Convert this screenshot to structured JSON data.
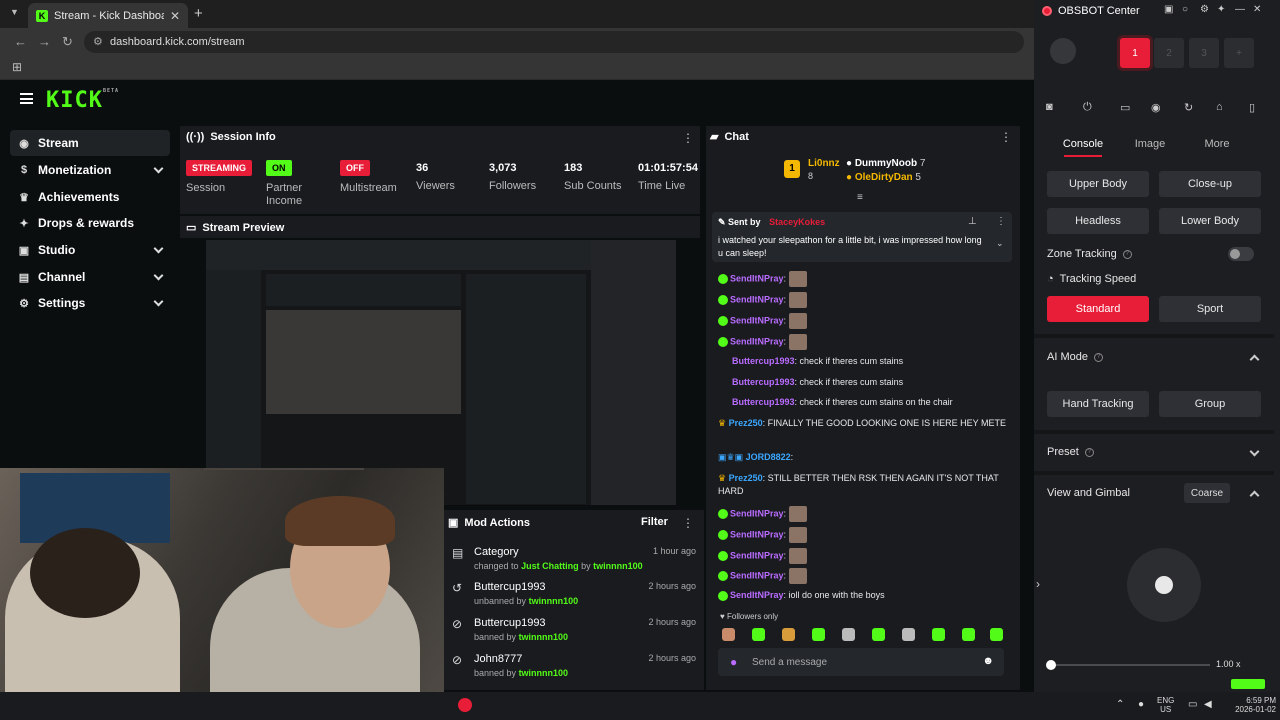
{
  "browser": {
    "tab_title": "Stream - Kick Dashboard",
    "url": "dashboard.kick.com/stream"
  },
  "kick": {
    "logo": "KICK",
    "logo_badge": "BETA",
    "sidebar": [
      {
        "label": "Stream",
        "icon": "broadcast-icon",
        "active": true
      },
      {
        "label": "Monetization",
        "icon": "dollar-icon",
        "expandable": true
      },
      {
        "label": "Achievements",
        "icon": "trophy-icon"
      },
      {
        "label": "Drops & rewards",
        "icon": "gift-icon"
      },
      {
        "label": "Studio",
        "icon": "studio-icon",
        "expandable": true
      },
      {
        "label": "Channel",
        "icon": "channel-icon",
        "expandable": true
      },
      {
        "label": "Settings",
        "icon": "gear-icon",
        "expandable": true
      }
    ],
    "session": {
      "title": "Session Info",
      "stats": [
        {
          "badge": "STREAMING",
          "label": "Session",
          "color": "#e81d38"
        },
        {
          "badge": "ON",
          "label": "Partner Income",
          "color": "#53fc18"
        },
        {
          "badge": "OFF",
          "label": "Multistream",
          "color": "#e81d38"
        },
        {
          "value": "36",
          "label": "Viewers"
        },
        {
          "value": "3,073",
          "label": "Followers"
        },
        {
          "value": "183",
          "label": "Sub Counts"
        },
        {
          "value": "01:01:57:54",
          "label": "Time Live"
        }
      ]
    },
    "preview": {
      "title": "Stream Preview"
    },
    "mod_actions": {
      "title": "Mod Actions",
      "filter": "Filter",
      "items": [
        {
          "user": "Category",
          "action": "changed to",
          "target": "Just Chatting",
          "by_word": "by",
          "by": "twinnnn100",
          "time": "1 hour ago",
          "icon": "category-icon"
        },
        {
          "user": "Buttercup1993",
          "action": "unbanned by",
          "by": "twinnnn100",
          "time": "2 hours ago",
          "icon": "unban-icon"
        },
        {
          "user": "Buttercup1993",
          "action": "banned by",
          "by": "twinnnn100",
          "time": "2 hours ago",
          "icon": "ban-icon"
        },
        {
          "user": "John8777",
          "action": "banned by",
          "by": "twinnnn100",
          "time": "2 hours ago",
          "icon": "ban-icon"
        }
      ]
    },
    "chat": {
      "title": "Chat",
      "leaderboard": [
        {
          "rank": "1",
          "name": "Li0nnz",
          "count": "8"
        },
        {
          "name": "DummyNoob",
          "count": "7"
        },
        {
          "name": "OleDirtyDan",
          "count": "5"
        }
      ],
      "pinned": {
        "sent_by": "Sent by",
        "author": "StaceyKokes",
        "text": "i watched your sleepathon for a little bit, i was impressed how long u can sleep!"
      },
      "lines": [
        {
          "user": "SendItNPray",
          "text": ":",
          "color": "#b96cff",
          "photo": true
        },
        {
          "user": "SendItNPray",
          "text": ":",
          "color": "#b96cff",
          "photo": true
        },
        {
          "user": "SendItNPray",
          "text": ":",
          "color": "#b96cff",
          "photo": true
        },
        {
          "user": "SendItNPray",
          "text": ":",
          "color": "#b96cff",
          "photo": true
        },
        {
          "user": "Buttercup1993",
          "text": ": check if theres cum stains",
          "color": "#b96cff"
        },
        {
          "user": "Buttercup1993",
          "text": ": check if theres cum stains",
          "color": "#b96cff"
        },
        {
          "user": "Buttercup1993",
          "text": ": check if theres cum stains on the chair",
          "color": "#b96cff"
        },
        {
          "user": "Prez250",
          "text": ": FINALLY THE GOOD LOOKING ONE IS HERE HEY METE",
          "color": "#3ba7ff"
        },
        {
          "user": "JORD8822",
          "text": ":",
          "color": "#3ba7ff"
        },
        {
          "user": "Prez250",
          "text": ": STILL BETTER THEN RSK THEN AGAIN IT'S NOT THAT HARD",
          "color": "#3ba7ff"
        },
        {
          "user": "SendItNPray",
          "text": ":",
          "color": "#b96cff",
          "photo": true
        },
        {
          "user": "SendItNPray",
          "text": ":",
          "color": "#b96cff",
          "photo": true
        },
        {
          "user": "SendItNPray",
          "text": ":",
          "color": "#b96cff",
          "photo": true
        },
        {
          "user": "SendItNPray",
          "text": ":",
          "color": "#b96cff",
          "photo": true
        },
        {
          "user": "SendItNPray",
          "text": ": ioll do one with the boys",
          "color": "#b96cff"
        }
      ],
      "followers_only": "Followers only",
      "input_placeholder": "Send a message"
    }
  },
  "obsbot": {
    "title": "OBSBOT Center",
    "slots": [
      "1",
      "2",
      "3",
      "+"
    ],
    "tabs": [
      "Console",
      "Image",
      "More"
    ],
    "framing_buttons": [
      "Upper Body",
      "Close-up",
      "Headless",
      "Lower Body"
    ],
    "zone_tracking": "Zone Tracking",
    "tracking_speed": "Tracking Speed",
    "speed_options": [
      "Standard",
      "Sport"
    ],
    "ai_mode": "AI Mode",
    "ai_options": [
      "Hand Tracking",
      "Group"
    ],
    "preset": "Preset",
    "view_gimbal": "View and Gimbal",
    "view_mode": "Coarse",
    "zoom": "1.00 x"
  },
  "taskbar": {
    "lang_top": "ENG",
    "lang_bottom": "US",
    "time": "6:59 PM",
    "date": "2026-01-02"
  },
  "colors": {
    "kick_green": "#53fc18",
    "live_red": "#e81d38",
    "obsbot_red": "#e81d38"
  }
}
